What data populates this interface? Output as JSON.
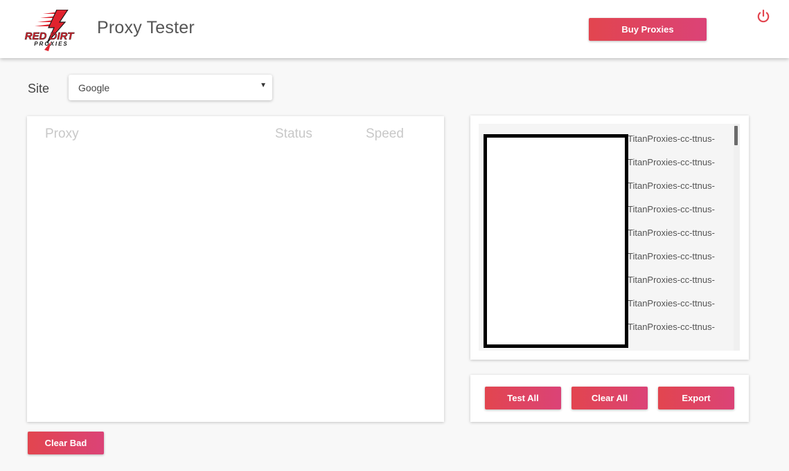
{
  "header": {
    "logo": {
      "line1": "RED DIRT",
      "line2": "PROXIES",
      "colors": {
        "red": "#e0232e",
        "dark": "#1a1a1a"
      }
    },
    "title": "Proxy Tester",
    "buy_label": "Buy Proxies",
    "power_icon": "power-icon"
  },
  "site": {
    "label": "Site",
    "selected": "Google"
  },
  "results": {
    "columns": [
      "Proxy",
      "Status",
      "Speed"
    ]
  },
  "proxy_list": {
    "lines": [
      "TitanProxies-cc-ttnus-",
      "TitanProxies-cc-ttnus-",
      "TitanProxies-cc-ttnus-",
      "TitanProxies-cc-ttnus-",
      "TitanProxies-cc-ttnus-",
      "TitanProxies-cc-ttnus-",
      "TitanProxies-cc-ttnus-",
      "TitanProxies-cc-ttnus-",
      "TitanProxies-cc-ttnus-"
    ]
  },
  "actions": {
    "test_all": "Test All",
    "clear_all": "Clear All",
    "export": "Export",
    "clear_bad": "Clear Bad"
  },
  "colors": {
    "accent_start": "#e2454f",
    "accent_end": "#db4377",
    "background": "#f8f8f8"
  }
}
